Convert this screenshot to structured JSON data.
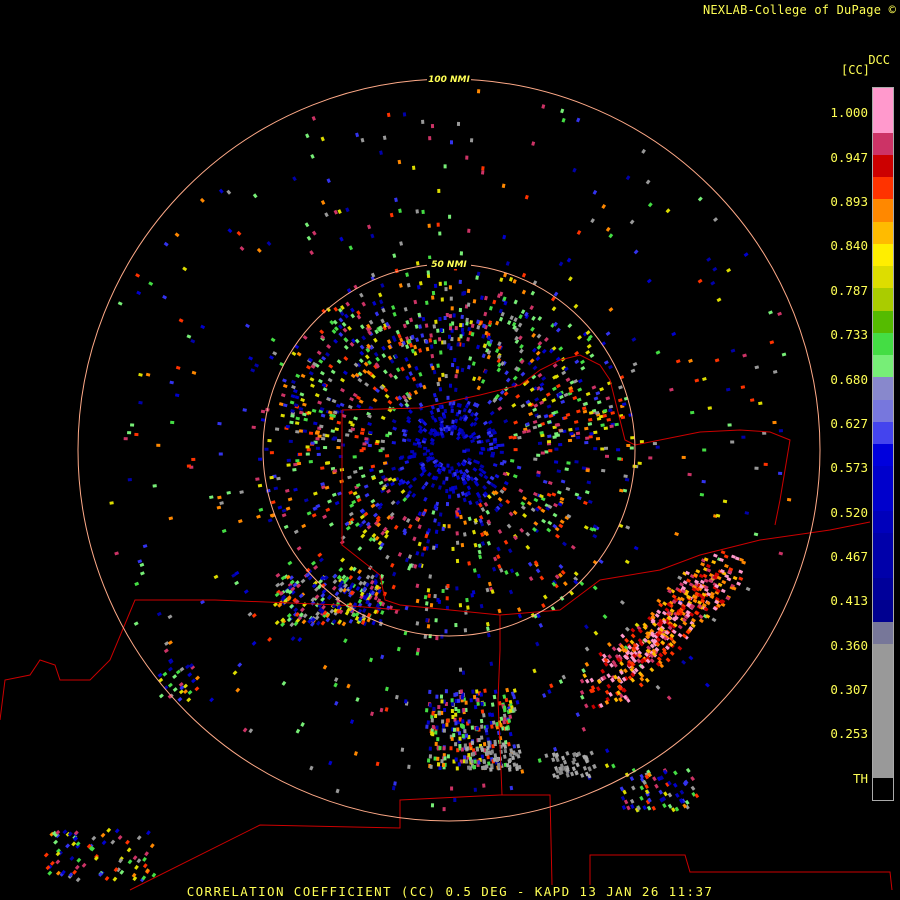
{
  "header": {
    "credit": "NEXLAB-College of DuPage ©"
  },
  "title": "CORRELATION COEFFICIENT (CC) 0.5 DEG - KAPD 13 JAN 26 11:37",
  "range_rings": [
    {
      "label": "100 NMI",
      "nmi": 100
    },
    {
      "label": "50 NMI",
      "nmi": 50
    }
  ],
  "colorbar": {
    "name": "DCC",
    "abbrev": "[CC]",
    "ticks": [
      "1.000",
      "0.947",
      "0.893",
      "0.840",
      "0.787",
      "0.733",
      "0.680",
      "0.627",
      "0.573",
      "0.520",
      "0.467",
      "0.413",
      "0.360",
      "0.307",
      "0.253",
      "TH"
    ],
    "colors": [
      "#ff99cc",
      "#ff99cc",
      "#cc3366",
      "#cc0000",
      "#ff3300",
      "#ff8800",
      "#ffbb00",
      "#ffee00",
      "#dddd00",
      "#aacc00",
      "#55bb00",
      "#44dd44",
      "#77ee77",
      "#8888cc",
      "#7777dd",
      "#4444ee",
      "#0000dd",
      "#0000cc",
      "#0000cc",
      "#0000bb",
      "#0000aa",
      "#0000aa",
      "#00009a",
      "#000090",
      "#777799",
      "#999999",
      "#999999",
      "#999999",
      "#999999",
      "#999999",
      "#999999",
      "#000000"
    ]
  },
  "colors": {
    "ring": "#ffaa88",
    "border": "#cc0000",
    "text": "#ffff55"
  }
}
